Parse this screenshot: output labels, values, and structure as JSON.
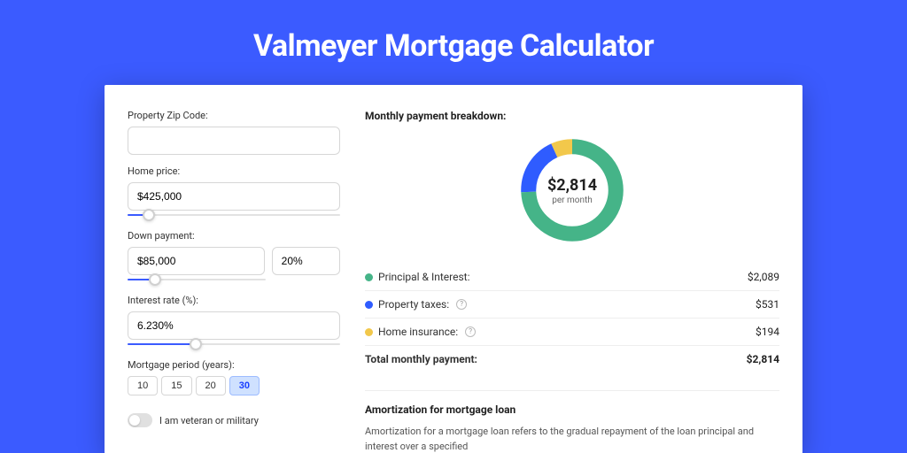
{
  "page": {
    "title": "Valmeyer Mortgage Calculator"
  },
  "colors": {
    "accent": "#3b5bff",
    "principal": "#45b488",
    "taxes": "#2f5cff",
    "insurance": "#f2c84b"
  },
  "form": {
    "zip": {
      "label": "Property Zip Code:",
      "value": ""
    },
    "price": {
      "label": "Home price:",
      "value": "$425,000",
      "slider_pct": 10
    },
    "down": {
      "label": "Down payment:",
      "amount": "$85,000",
      "pct": "20%",
      "slider_pct": 20
    },
    "rate": {
      "label": "Interest rate (%):",
      "value": "6.230%",
      "slider_pct": 32
    },
    "period": {
      "label": "Mortgage period (years):",
      "options": [
        "10",
        "15",
        "20",
        "30"
      ],
      "active_index": 3
    },
    "veteran": {
      "label": "I am veteran or military",
      "on": false
    }
  },
  "breakdown": {
    "title": "Monthly payment breakdown:",
    "donut": {
      "amount": "$2,814",
      "sub": "per month"
    },
    "rows": [
      {
        "label": "Principal & Interest:",
        "value": "$2,089",
        "color_key": "principal",
        "info": false
      },
      {
        "label": "Property taxes:",
        "value": "$531",
        "color_key": "taxes",
        "info": true
      },
      {
        "label": "Home insurance:",
        "value": "$194",
        "color_key": "insurance",
        "info": true
      }
    ],
    "total": {
      "label": "Total monthly payment:",
      "value": "$2,814"
    }
  },
  "amort": {
    "title": "Amortization for mortgage loan",
    "text": "Amortization for a mortgage loan refers to the gradual repayment of the loan principal and interest over a specified"
  },
  "chart_data": {
    "type": "pie",
    "title": "Monthly payment breakdown",
    "categories": [
      "Principal & Interest",
      "Property taxes",
      "Home insurance"
    ],
    "values": [
      2089,
      531,
      194
    ],
    "colors": [
      "#45b488",
      "#2f5cff",
      "#f2c84b"
    ],
    "total": 2814,
    "ylabel": "USD per month"
  }
}
